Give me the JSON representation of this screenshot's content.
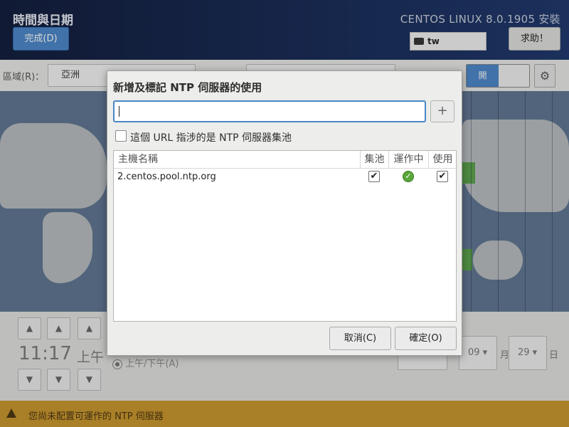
{
  "header": {
    "title": "時間與日期",
    "done_label": "完成(D)",
    "product": "CENTOS LINUX 8.0.1905 安裝",
    "keyboard_layout": "tw",
    "help_label": "求助！"
  },
  "region": {
    "label": "區域(R)：",
    "value": "亞洲"
  },
  "ntp_toggle": {
    "on_label": "開"
  },
  "time": {
    "clock": "11:17",
    "ampm": "上午",
    "format_label": "上午/下午(A)"
  },
  "date": {
    "month": "09",
    "month_unit": "月",
    "day": "29",
    "day_unit": "日"
  },
  "warning": {
    "text": "您尚未配置可運作的 NTP 伺服器"
  },
  "dialog": {
    "title": "新增及標記 NTP 伺服器的使用",
    "input_value": "",
    "add_symbol": "+",
    "pool_checkbox_label": "這個 URL 指涉的是 NTP 伺服器集池",
    "columns": {
      "host": "主機名稱",
      "pool": "集池",
      "working": "運作中",
      "use": "使用"
    },
    "rows": [
      {
        "host": "2.centos.pool.ntp.org",
        "pool": true,
        "working": true,
        "use": true
      }
    ],
    "cancel_label": "取消(C)",
    "ok_label": "確定(O)"
  },
  "colors": {
    "accent": "#4a86c8",
    "header_bg": "#162a57",
    "warning_bar": "#c8952a",
    "working_ok": "#5aa63a"
  }
}
